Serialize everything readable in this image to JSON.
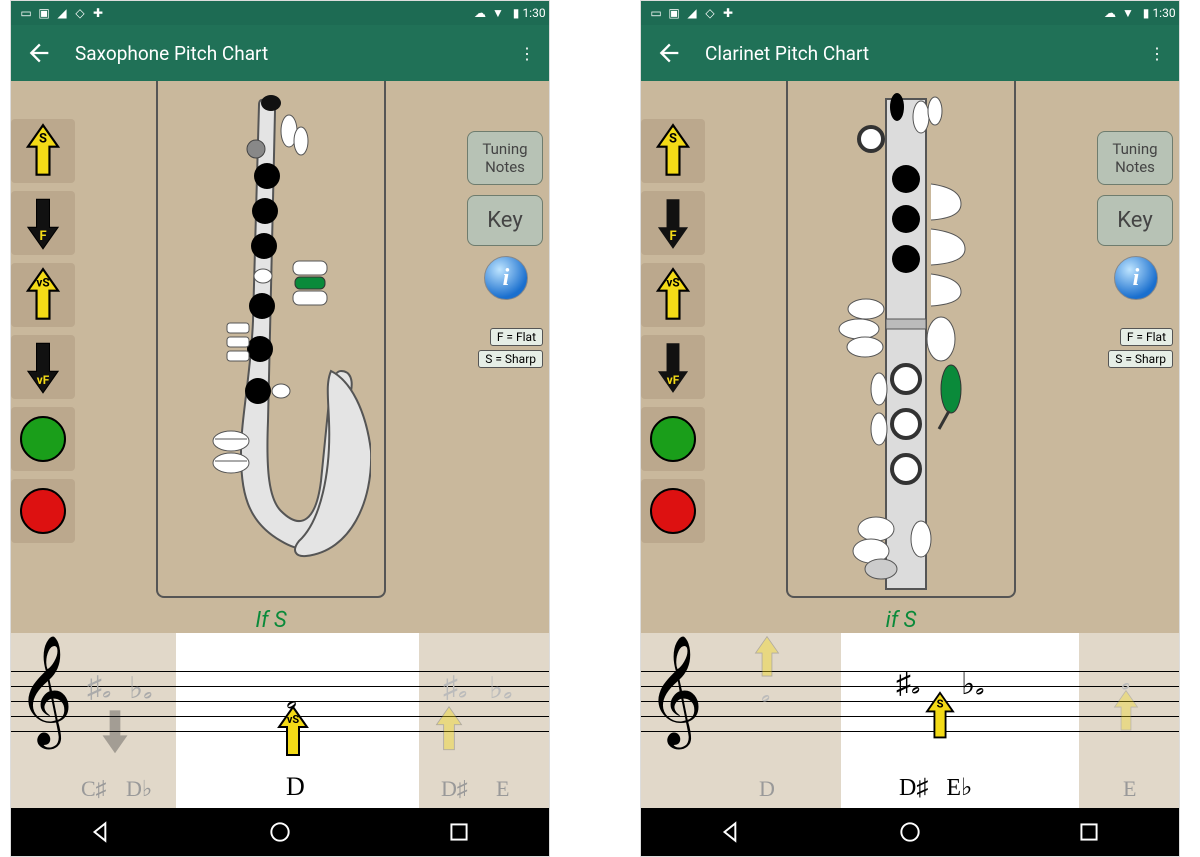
{
  "screens": [
    {
      "status": {
        "time": "1:30"
      },
      "appbar": {
        "title": "Saxophone Pitch Chart"
      },
      "left_buttons": [
        {
          "label": "S",
          "dir": "up",
          "color": "yellow"
        },
        {
          "label": "F",
          "dir": "down",
          "color": "black"
        },
        {
          "label": "vS",
          "dir": "up",
          "color": "yellow"
        },
        {
          "label": "vF",
          "dir": "down",
          "color": "black"
        }
      ],
      "circles": [
        "green",
        "red"
      ],
      "center_label": "If S",
      "right": {
        "tuning": "Tuning\nNotes",
        "key": "Key",
        "info": "i"
      },
      "legend": [
        "F = Flat",
        "S = Sharp"
      ],
      "staff": {
        "highlight_note": "D",
        "left_labels": [
          "C♯",
          "D♭"
        ],
        "right_labels": [
          "D♯",
          "E"
        ],
        "marker_label": "vS"
      }
    },
    {
      "status": {
        "time": "1:30"
      },
      "appbar": {
        "title": "Clarinet Pitch Chart"
      },
      "left_buttons": [
        {
          "label": "S",
          "dir": "up",
          "color": "yellow"
        },
        {
          "label": "F",
          "dir": "down",
          "color": "black"
        },
        {
          "label": "vS",
          "dir": "up",
          "color": "yellow"
        },
        {
          "label": "vF",
          "dir": "down",
          "color": "black"
        }
      ],
      "circles": [
        "green",
        "red"
      ],
      "center_label": "if S",
      "right": {
        "tuning": "Tuning\nNotes",
        "key": "Key",
        "info": "i"
      },
      "legend": [
        "F = Flat",
        "S = Sharp"
      ],
      "staff": {
        "highlight_note": "D♯   E♭",
        "left_labels": [
          "D"
        ],
        "right_labels": [
          "E"
        ],
        "marker_label": "S"
      }
    }
  ]
}
